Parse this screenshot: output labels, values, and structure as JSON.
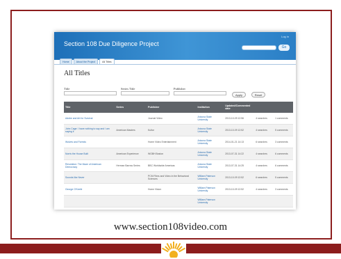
{
  "slide": {
    "url": "www.section108video.com",
    "colors": {
      "frame": "#8c1d1d",
      "banner": "#2b7fc6"
    }
  },
  "app": {
    "title": "Section 108 Due Diligence Project",
    "login": "Log in",
    "search_placeholder": "",
    "search_button": "Go",
    "tabs": [
      "Home",
      "About the Project",
      "All Titles"
    ],
    "active_tab": "All Titles"
  },
  "page": {
    "title": "All Titles",
    "filters": {
      "title_label": "Title",
      "series_label": "Series Title",
      "publisher_label": "Publisher",
      "apply": "Apply",
      "reset": "Reset"
    }
  },
  "table": {
    "columns": [
      "Title",
      "Series",
      "Publisher",
      "Institution",
      "Updated/Commented date",
      "",
      ""
    ],
    "rows": [
      [
        "Adobe and Art for Survival",
        "",
        "Journal Video",
        "Arizona State University",
        "2013-10-09 12:56",
        "4 searches",
        "1 comments"
      ],
      [
        "John Cage: I have nothing to say and I am saying it",
        "American Masters",
        "Kultur",
        "Arizona State University",
        "2013-10-09 12:52",
        "4 searches",
        "5 comments"
      ],
      [
        "Wolves and Forests",
        "",
        "Home Video Entertainment",
        "Arizona State University",
        "2014-01-21 14:13",
        "6 searches",
        "3 comments"
      ],
      [
        "Norris the House Built",
        "American Experience",
        "WGBH Boston",
        "Arizona State University",
        "2013-07-31 14:22",
        "4 searches",
        "6 comments"
      ],
      [
        "Revolution: The Maze of American Democracy",
        "Herman Barrow Series",
        "BBC Worldwide Americas",
        "Arizona State University",
        "2013-07-31 14:25",
        "4 searches",
        "6 comments"
      ],
      [
        "Sounds like Never",
        "",
        "PCM Films and Video in the Behavioral Sciences",
        "William Paterson University",
        "2013-10-09 12:52",
        "6 searches",
        "5 comments"
      ],
      [
        "George O'Keefe",
        "",
        "Home Vision",
        "William Paterson University",
        "2013-10-09 12:52",
        "4 searches",
        "3 comments"
      ],
      [
        "",
        "",
        "",
        "William Paterson University",
        "",
        "",
        ""
      ]
    ]
  }
}
